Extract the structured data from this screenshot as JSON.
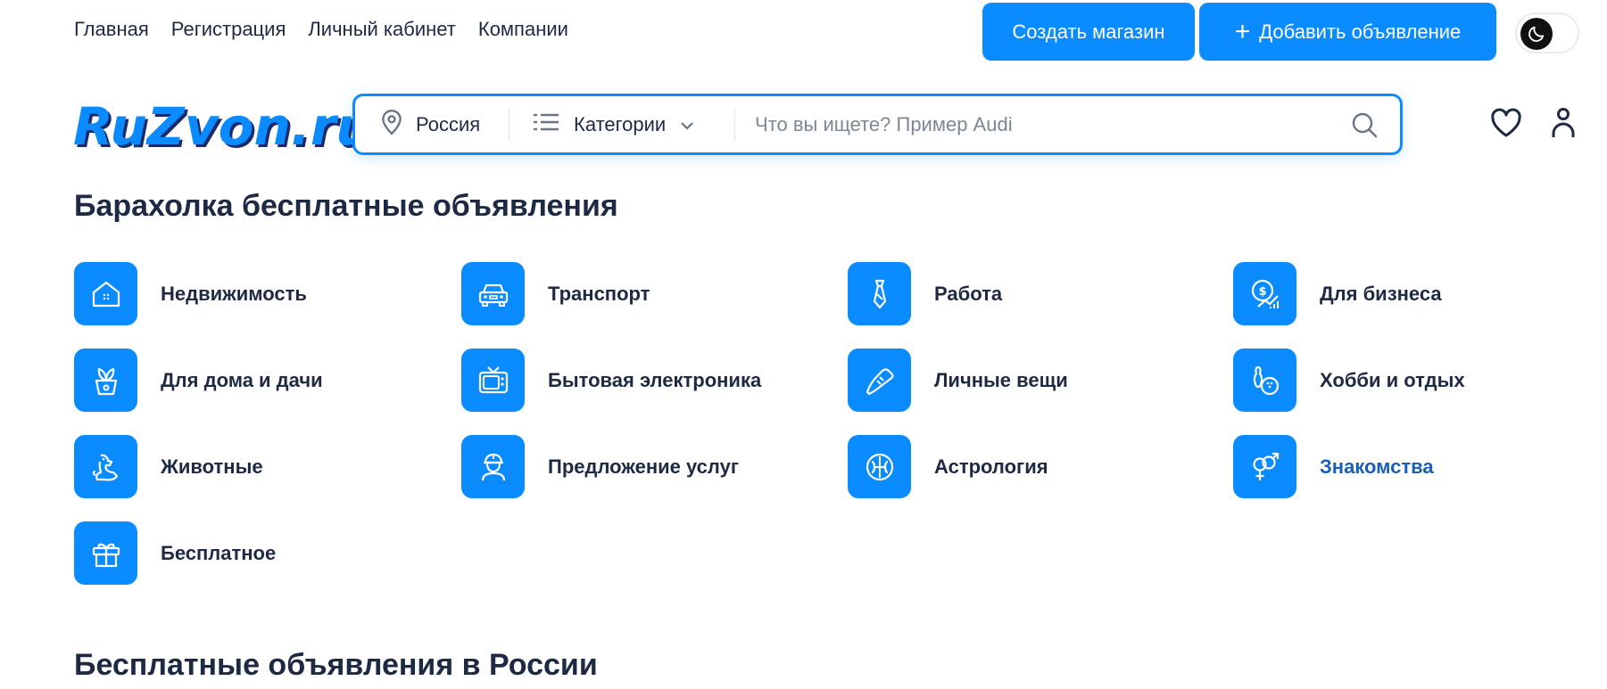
{
  "nav": {
    "links": [
      "Главная",
      "Регистрация",
      "Личный кабинет",
      "Компании"
    ],
    "create_shop": "Создать магазин",
    "add_ad": "Добавить объявление"
  },
  "logo": "RuZvon.ru",
  "search": {
    "region": "Россия",
    "categories": "Категории",
    "placeholder": "Что вы ищете? Пример Audi"
  },
  "heading_main": "Барахолка бесплатные объявления",
  "categories": [
    {
      "label": "Недвижимость",
      "icon": "house-icon"
    },
    {
      "label": "Транспорт",
      "icon": "car-icon"
    },
    {
      "label": "Работа",
      "icon": "tie-icon"
    },
    {
      "label": "Для бизнеса",
      "icon": "money-growth-icon"
    },
    {
      "label": "Для дома и дачи",
      "icon": "plant-pot-icon"
    },
    {
      "label": "Бытовая электроника",
      "icon": "tv-icon"
    },
    {
      "label": "Личные вещи",
      "icon": "sneaker-icon"
    },
    {
      "label": "Хобби и отдых",
      "icon": "bowling-icon"
    },
    {
      "label": "Животные",
      "icon": "dog-icon"
    },
    {
      "label": "Предложение услуг",
      "icon": "worker-icon"
    },
    {
      "label": "Астрология",
      "icon": "zodiac-icon"
    },
    {
      "label": "Знакомства",
      "icon": "gender-icon"
    },
    {
      "label": "Бесплатное",
      "icon": "gift-icon"
    }
  ],
  "heading_second": "Бесплатные объявления в России",
  "colors": {
    "accent": "#0a8bff",
    "text": "#1e2a44",
    "link": "#1a5fb4"
  }
}
